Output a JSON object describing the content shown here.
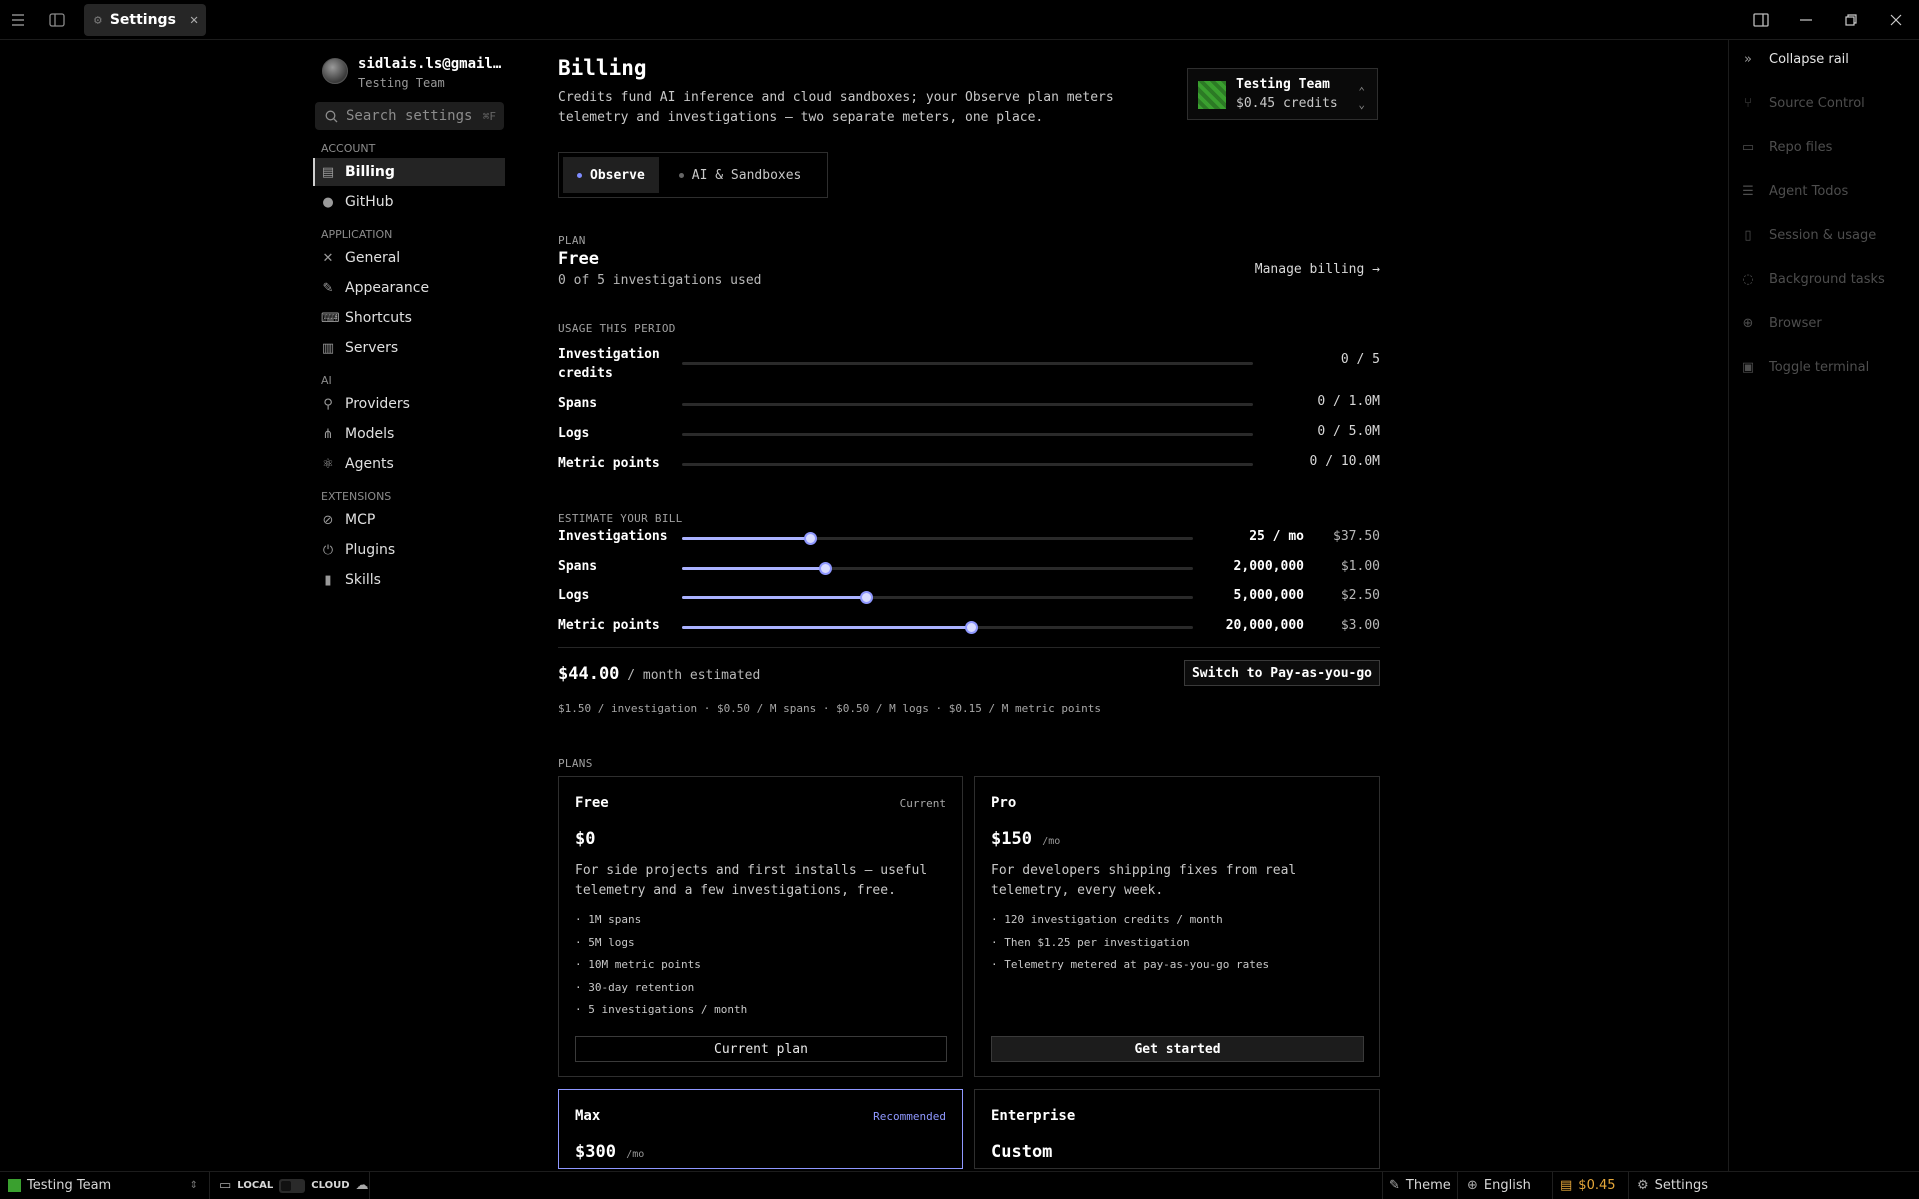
{
  "titlebar": {
    "tab_label": "Settings"
  },
  "user": {
    "email": "sidlais.ls@gmail…",
    "team": "Testing Team"
  },
  "search": {
    "placeholder": "Search settings",
    "shortcut": "⌘F"
  },
  "nav": {
    "account_label": "ACCOUNT",
    "account": [
      {
        "label": "Billing",
        "icon": "wallet-icon",
        "active": true
      },
      {
        "label": "GitHub",
        "icon": "github-icon"
      }
    ],
    "application_label": "APPLICATION",
    "application": [
      {
        "label": "General",
        "icon": "tools-icon"
      },
      {
        "label": "Appearance",
        "icon": "brush-icon"
      },
      {
        "label": "Shortcuts",
        "icon": "keyboard-icon"
      },
      {
        "label": "Servers",
        "icon": "building-icon"
      }
    ],
    "ai_label": "AI",
    "ai": [
      {
        "label": "Providers",
        "icon": "plug-icon"
      },
      {
        "label": "Models",
        "icon": "nodes-icon"
      },
      {
        "label": "Agents",
        "icon": "atom-icon"
      }
    ],
    "extensions_label": "EXTENSIONS",
    "extensions": [
      {
        "label": "MCP",
        "icon": "mcp-icon"
      },
      {
        "label": "Plugins",
        "icon": "plug-icon"
      },
      {
        "label": "Skills",
        "icon": "bars-icon"
      }
    ]
  },
  "billing": {
    "title": "Billing",
    "description": "Credits fund AI inference and cloud sandboxes; your Observe plan meters telemetry and investigations — two separate meters, one place.",
    "team_card": {
      "name": "Testing Team",
      "credits": "$0.45 credits"
    },
    "tabs": [
      "Observe",
      "AI & Sandboxes"
    ],
    "plan_label": "PLAN",
    "plan_name": "Free",
    "plan_usage": "0 of 5 investigations used",
    "manage_billing": "Manage billing →",
    "usage_label": "USAGE THIS PERIOD",
    "usage": [
      {
        "name": "Investigation credits",
        "value": "0 / 5"
      },
      {
        "name": "Spans",
        "value": "0 / 1.0M"
      },
      {
        "name": "Logs",
        "value": "0 / 5.0M"
      },
      {
        "name": "Metric points",
        "value": "0 / 10.0M"
      }
    ],
    "estimate_label": "ESTIMATE YOUR BILL",
    "estimate": [
      {
        "name": "Investigations",
        "qty": "25 / mo",
        "cost": "$37.50",
        "level": 0.25
      },
      {
        "name": "Spans",
        "qty": "2,000,000",
        "cost": "$1.00",
        "level": 0.28
      },
      {
        "name": "Logs",
        "qty": "5,000,000",
        "cost": "$2.50",
        "level": 0.36
      },
      {
        "name": "Metric points",
        "qty": "20,000,000",
        "cost": "$3.00",
        "level": 0.565
      }
    ],
    "total": "$44.00",
    "total_suffix": " / month estimated",
    "payg_button": "Switch to Pay-as-you-go",
    "rates": "$1.50 / investigation · $0.50 / M spans · $0.50 / M logs · $0.15 / M metric points",
    "plans_label": "PLANS",
    "plans": {
      "free": {
        "name": "Free",
        "badge": "Current",
        "price": "$0",
        "description": "For side projects and first installs — useful telemetry and a few investigations, free.",
        "features": [
          "· 1M spans",
          "· 5M logs",
          "· 10M metric points",
          "· 30-day retention",
          "· 5 investigations / month"
        ],
        "button": "Current plan"
      },
      "pro": {
        "name": "Pro",
        "price": "$150",
        "per": "/mo",
        "description": "For developers shipping fixes from real telemetry, every week.",
        "features": [
          "· 120 investigation credits / month",
          "· Then $1.25 per investigation",
          "· Telemetry metered at pay-as-you-go rates"
        ],
        "button": "Get started"
      },
      "max": {
        "name": "Max",
        "badge": "Recommended",
        "price": "$300",
        "per": "/mo"
      },
      "enterprise": {
        "name": "Enterprise",
        "price": "Custom"
      }
    }
  },
  "rail": {
    "collapse": "Collapse rail",
    "items": [
      "Source Control",
      "Repo files",
      "Agent Todos",
      "Session & usage",
      "Background tasks",
      "Browser",
      "Toggle terminal"
    ]
  },
  "statusbar": {
    "team": "Testing Team",
    "local": "LOCAL",
    "cloud": "CLOUD",
    "theme": "Theme",
    "language": "English",
    "credits": "$0.45",
    "settings": "Settings"
  },
  "colors": {
    "accent": "#8f98ff",
    "slider_fill": "#aab2ff",
    "team_green": "#3aa02f",
    "credits_amber": "#e6a83a"
  }
}
